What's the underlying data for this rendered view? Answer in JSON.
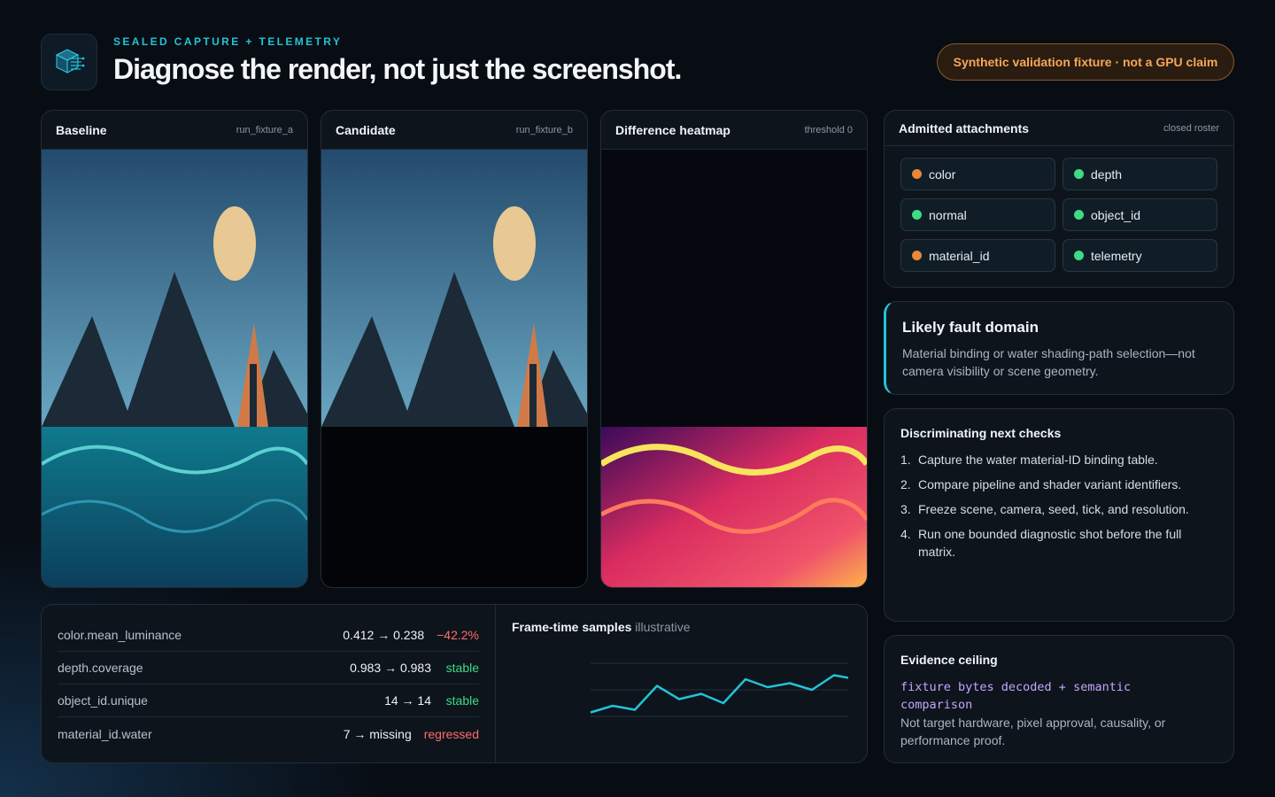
{
  "header": {
    "eyebrow": "SEALED CAPTURE + TELEMETRY",
    "title": "Diagnose the render, not just the screenshot.",
    "badge": "Synthetic validation fixture · not a GPU claim",
    "logo_icon": "cube-circuit-icon"
  },
  "panels": {
    "baseline": {
      "title": "Baseline",
      "tag": "run_fixture_a"
    },
    "candidate": {
      "title": "Candidate",
      "tag": "run_fixture_b"
    },
    "heatmap": {
      "title": "Difference heatmap",
      "tag": "threshold 0"
    }
  },
  "attachments": {
    "title": "Admitted attachments",
    "tag": "closed roster",
    "items": [
      {
        "label": "color",
        "status_color": "#e8883a"
      },
      {
        "label": "depth",
        "status_color": "#3ddc84"
      },
      {
        "label": "normal",
        "status_color": "#3ddc84"
      },
      {
        "label": "object_id",
        "status_color": "#3ddc84"
      },
      {
        "label": "material_id",
        "status_color": "#e8883a"
      },
      {
        "label": "telemetry",
        "status_color": "#3ddc84"
      }
    ]
  },
  "fault": {
    "title": "Likely fault domain",
    "text": "Material binding or water shading-path selection—not camera visibility or scene geometry."
  },
  "checks": {
    "title": "Discriminating next checks",
    "items": [
      {
        "n": "1.",
        "text": "Capture the water material-ID binding table."
      },
      {
        "n": "2.",
        "text": "Compare pipeline and shader variant identifiers."
      },
      {
        "n": "3.",
        "text": "Freeze scene, camera, seed, tick, and resolution."
      },
      {
        "n": "4.",
        "text": "Run one bounded diagnostic shot before the full matrix."
      }
    ]
  },
  "ceiling": {
    "title": "Evidence ceiling",
    "code": "fixture bytes decoded + semantic comparison",
    "text": "Not target hardware, pixel approval, causality, or performance proof."
  },
  "metrics": [
    {
      "key": "color.mean_luminance",
      "value": "0.412 → 0.238",
      "status": "−42.2%",
      "status_color": "#ff6b6b"
    },
    {
      "key": "depth.coverage",
      "value": "0.983 → 0.983",
      "status": "stable",
      "status_color": "#3ddc84"
    },
    {
      "key": "object_id.unique",
      "value": "14 → 14",
      "status": "stable",
      "status_color": "#3ddc84"
    },
    {
      "key": "material_id.water",
      "value": "7 → missing",
      "status": "regressed",
      "status_color": "#ff6b6b"
    }
  ],
  "frametime": {
    "title": "Frame-time samples",
    "subtitle": "illustrative"
  },
  "chart_data": {
    "type": "line",
    "title": "Frame-time samples",
    "xlabel": "",
    "ylabel": "",
    "x": [
      1,
      2,
      3,
      4,
      5,
      6,
      7,
      8,
      9,
      10,
      11,
      12,
      13
    ],
    "series": [
      {
        "values": [
          0.3,
          0.8,
          0.5,
          2.3,
          1.3,
          1.7,
          1.0,
          2.8,
          2.2,
          2.5,
          2.0,
          3.1,
          2.8
        ]
      }
    ],
    "ylim": [
      0,
      4
    ],
    "grid": true,
    "color": "#22c3d6"
  }
}
